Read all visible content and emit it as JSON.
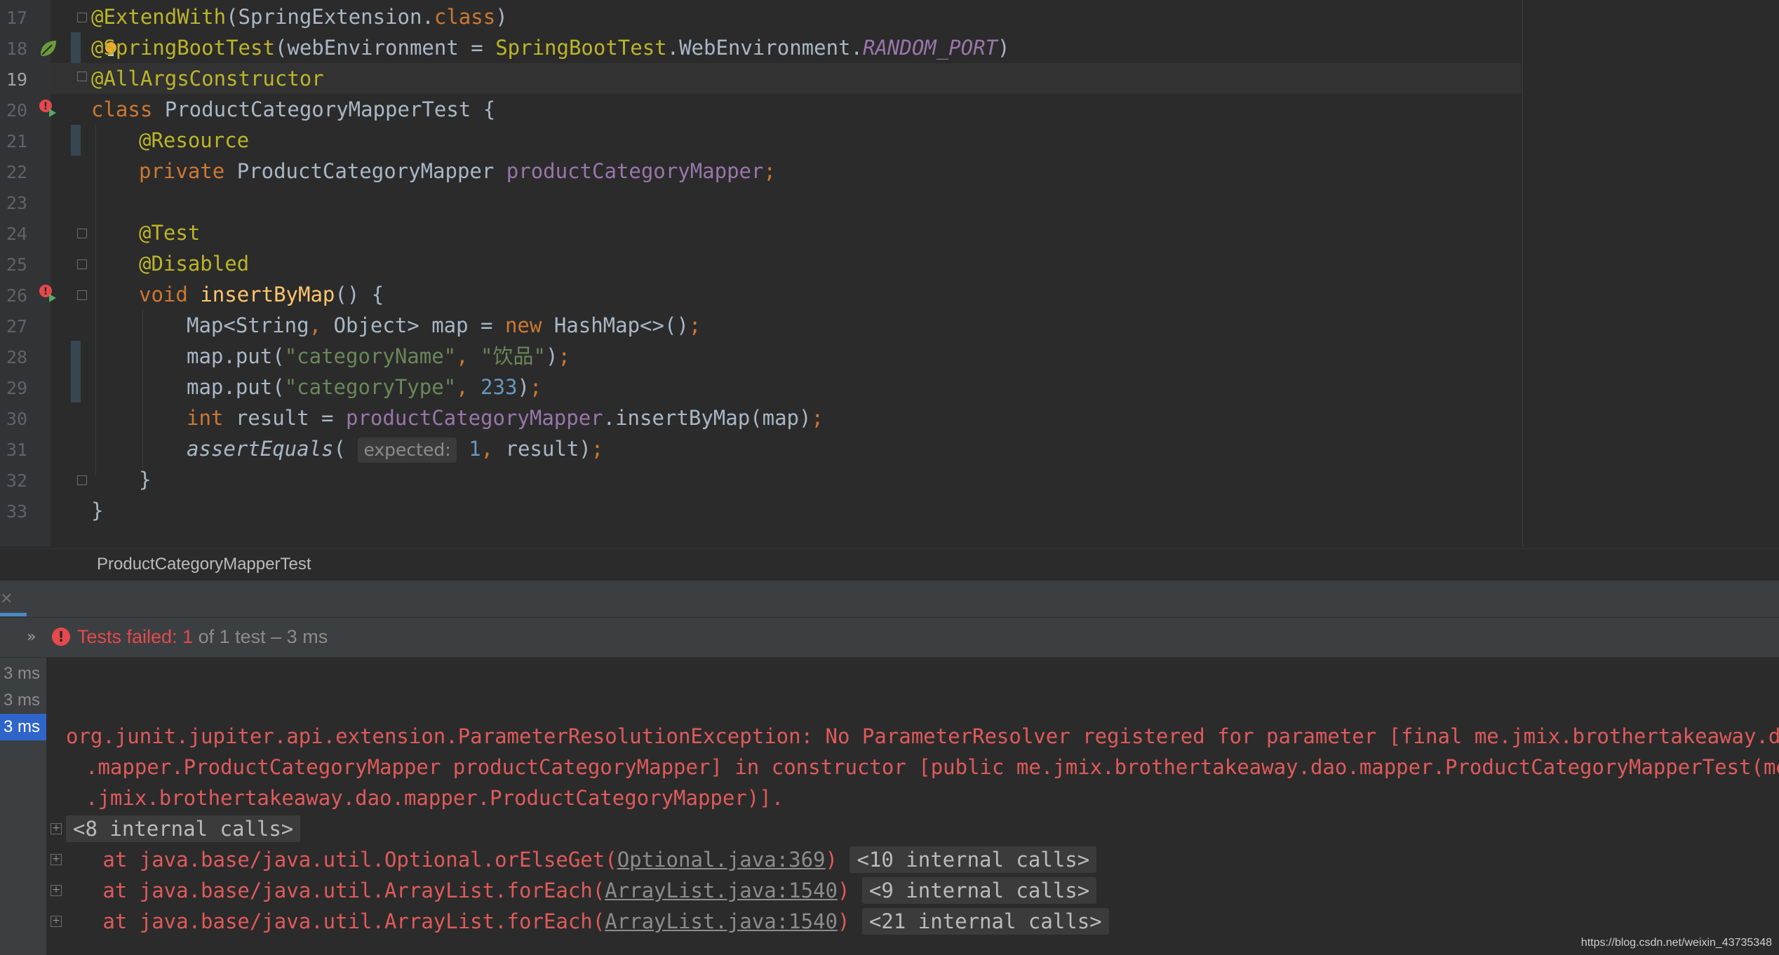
{
  "editor": {
    "line_numbers": [
      "17",
      "18",
      "19",
      "20",
      "21",
      "22",
      "23",
      "24",
      "25",
      "26",
      "27",
      "28",
      "29",
      "30",
      "31",
      "32",
      "33"
    ],
    "lines": {
      "l17": {
        "at": "@ExtendWith",
        "p1": "(SpringExtension.",
        "kw": "class",
        "p2": ")"
      },
      "l18": {
        "at": "@",
        "ann": "SpringBootTest",
        "p1": "(webEnvironment = ",
        "cls": "SpringBootTest",
        "p2": ".WebEnvironment.",
        "static": "RANDOM_PORT",
        "p3": ")"
      },
      "l19": {
        "ann": "@AllArgsConstructor"
      },
      "l20": {
        "kw": "class ",
        "name": "ProductCategoryMapperTest {"
      },
      "l21": {
        "ann": "@Resource"
      },
      "l22": {
        "kw": "private ",
        "type": "ProductCategoryMapper ",
        "field": "productCategoryMapper",
        "semi": ";"
      },
      "l23": {},
      "l24": {
        "ann": "@Test"
      },
      "l25": {
        "ann": "@Disabled"
      },
      "l26": {
        "kw": "void ",
        "fn": "insertByMap",
        "rest": "() {"
      },
      "l27": {
        "p1": "Map<String",
        "c": ", ",
        "p2": "Object> map = ",
        "kw": "new ",
        "p3": "HashMap<>()",
        "semi": ";"
      },
      "l28": {
        "p1": "map.put(",
        "s1": "\"categoryName\"",
        "c": ", ",
        "s2": "\"饮品\"",
        "p2": ")",
        "semi": ";"
      },
      "l29": {
        "p1": "map.put(",
        "s1": "\"categoryType\"",
        "c": ", ",
        "num": "233",
        "p2": ")",
        "semi": ";"
      },
      "l30": {
        "kw": "int ",
        "p1": "result = ",
        "field": "productCategoryMapper",
        "p2": ".insertByMap(map)",
        "semi": ";"
      },
      "l31": {
        "fn": "assertEquals",
        "p1": "( ",
        "hint": "expected:",
        "num": "1",
        "c": ", ",
        "p2": "result)",
        "semi": ";"
      },
      "l32": {
        "p1": "}"
      },
      "l33": {
        "p1": "}"
      }
    }
  },
  "breadcrumb": {
    "label": "ProductCategoryMapperTest"
  },
  "run_panel": {
    "status_prefix": "Tests failed: ",
    "failed_count": "1",
    "status_suffix": " of 1 test – 3 ms",
    "timings": [
      "3 ms",
      "3 ms",
      "3 ms"
    ],
    "console": {
      "exception_lines": [
        "org.junit.jupiter.api.extension.ParameterResolutionException: No ParameterResolver registered for parameter [final me.jmix.brothertakeaway.dao",
        ".mapper.ProductCategoryMapper productCategoryMapper] in constructor [public me.jmix.brothertakeaway.dao.mapper.ProductCategoryMapperTest(me",
        ".jmix.brothertakeaway.dao.mapper.ProductCategoryMapper)]."
      ],
      "internal_first": "<8 internal calls>",
      "stack": [
        {
          "at": "   at java.base/java.util.Optional.orElseGet(",
          "link": "Optional.java:369",
          "close": ")",
          "internal": "<10 internal calls>"
        },
        {
          "at": "   at java.base/java.util.ArrayList.forEach(",
          "link": "ArrayList.java:1540",
          "close": ")",
          "internal": "<9 internal calls>"
        },
        {
          "at": "   at java.base/java.util.ArrayList.forEach(",
          "link": "ArrayList.java:1540",
          "close": ")",
          "internal": "<21 internal calls>"
        }
      ]
    }
  },
  "watermark": "https://blog.csdn.net/weixin_43735348",
  "colors": {
    "keyword": "#cc7832",
    "annotation": "#bbb529",
    "string": "#6a8759",
    "number": "#6897bb",
    "field": "#9876aa",
    "error": "#e05a5a",
    "selection": "#2f65ca"
  }
}
